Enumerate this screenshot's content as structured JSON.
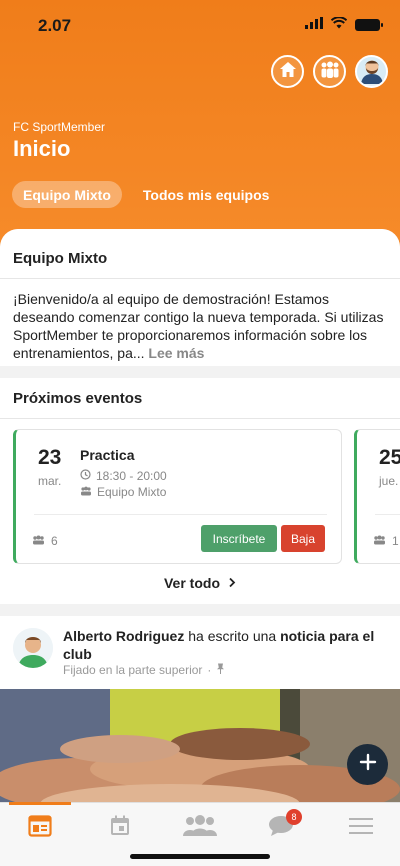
{
  "status": {
    "time": "2.07"
  },
  "header": {
    "club": "FC SportMember",
    "title": "Inicio",
    "tabs": [
      {
        "label": "Equipo Mixto",
        "active": true
      },
      {
        "label": "Todos mis equipos",
        "active": false
      }
    ],
    "accent": "#f07d1a"
  },
  "team": {
    "title": "Equipo Mixto",
    "description": "¡Bienvenido/a al equipo de demostración! Estamos deseando comenzar contigo la nueva temporada. Si utilizas SportMember te proporcionaremos información sobre los entrenamientos, pa...",
    "more": "Lee más"
  },
  "events": {
    "title": "Próximos eventos",
    "items": [
      {
        "day": "23",
        "weekday": "mar.",
        "name": "Practica",
        "time": "18:30 - 20:00",
        "team": "Equipo Mixto",
        "count": "6",
        "signup": "Inscríbete",
        "drop": "Baja"
      },
      {
        "day": "25",
        "weekday": "jue.",
        "count": "1"
      }
    ],
    "see_all": "Ver todo"
  },
  "news": {
    "author": "Alberto Rodriguez",
    "verb": "ha escrito una",
    "object": "noticia para el club",
    "pinned": "Fijado en la parte superior"
  },
  "nav": {
    "badge": "8",
    "items": [
      "home-icon",
      "calendar-icon",
      "members-icon",
      "chat-icon",
      "menu-icon"
    ]
  }
}
